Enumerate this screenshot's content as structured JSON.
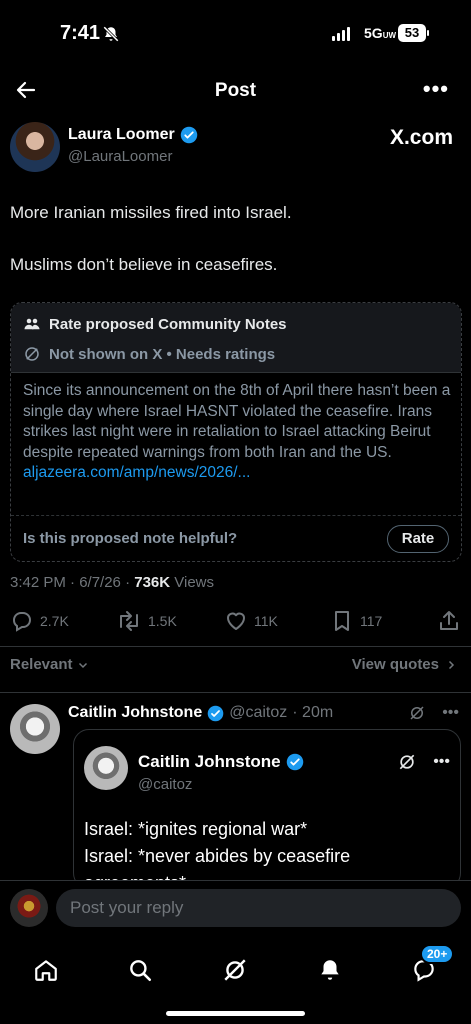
{
  "status": {
    "time": "7:41",
    "network": "5G",
    "network_suffix": "UW",
    "battery": "53"
  },
  "header": {
    "title": "Post"
  },
  "post": {
    "author_name": "Laura Loomer",
    "author_handle": "@LauraLoomer",
    "watermark": "X.com",
    "lines": [
      "More Iranian missiles fired into Israel.",
      "Muslims don’t believe in ceasefires."
    ],
    "timestamp": "3:42 PM · 6/7/26 · ",
    "views_count": "736K",
    "views_label": " Views"
  },
  "community_note": {
    "title": "Rate proposed Community Notes",
    "status": "Not shown on X • Needs ratings",
    "body": "Since its announcement on the 8th of April there hasn’t been a single day where Israel HASNT violated the ceasefire. Irans strikes last night were in retaliation to Israel attacking Beirut despite repeated warnings from both Iran and the US.",
    "link": "aljazeera.com/amp/news/2026/...",
    "question": "Is this proposed note helpful?",
    "rate_label": "Rate"
  },
  "actions": {
    "replies": "2.7K",
    "reposts": "1.5K",
    "likes": "11K",
    "bookmarks": "117"
  },
  "sort": {
    "label": "Relevant",
    "view_quotes": "View quotes"
  },
  "reply": {
    "name": "Caitlin Johnstone",
    "handle": "@caitoz",
    "time": "· 20m",
    "quote_name": "Caitlin Johnstone",
    "quote_handle": "@caitoz",
    "quote_lines": [
      "Israel: *ignites regional war*",
      "Israel: *never abides by ceasefire",
      "agreements*"
    ]
  },
  "composer": {
    "placeholder": "Post your reply"
  },
  "tabbar": {
    "badge": "20+"
  },
  "colors": {
    "accent": "#1d9bf0",
    "background": "#000000",
    "muted": "#71767b"
  }
}
